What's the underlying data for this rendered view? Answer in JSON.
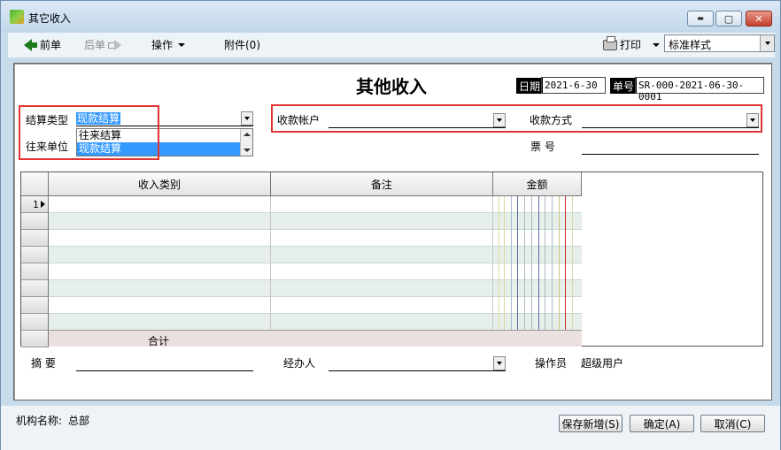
{
  "window": {
    "title": "其它收入",
    "minimize": "▬",
    "maximize": "▢",
    "close": "✕"
  },
  "toolbar": {
    "prev": "前单",
    "next": "后单",
    "operate": "操作",
    "attachment": "附件(0)",
    "print": "打印",
    "style_value": "标准样式"
  },
  "form": {
    "title": "其他收入",
    "date_label": "日期",
    "date_value": "2021-6-30",
    "number_label": "单号",
    "number_value": "SR-000-2021-06-30-0001",
    "settle_type_label": "结算类型",
    "settle_type_value": "现款结算",
    "settle_options": [
      "往来结算",
      "现款结算"
    ],
    "partner_label": "往来单位",
    "account_label": "收款帐户",
    "account_value": "",
    "method_label": "收款方式",
    "method_value": "",
    "ticket_label": "票  号",
    "ticket_value": "",
    "summary_label": "摘  要",
    "summary_value": "",
    "handler_label": "经办人",
    "handler_value": "",
    "operator_label": "操作员",
    "operator_value": "超级用户"
  },
  "grid": {
    "columns": [
      "收入类别",
      "备注",
      "金额"
    ],
    "first_row_number": "1",
    "total_label": "合计"
  },
  "footer": {
    "org_label": "机构名称:",
    "org_value": "总部",
    "save_new": "保存新增(S)",
    "confirm": "确定(A)",
    "cancel": "取消(C)"
  }
}
